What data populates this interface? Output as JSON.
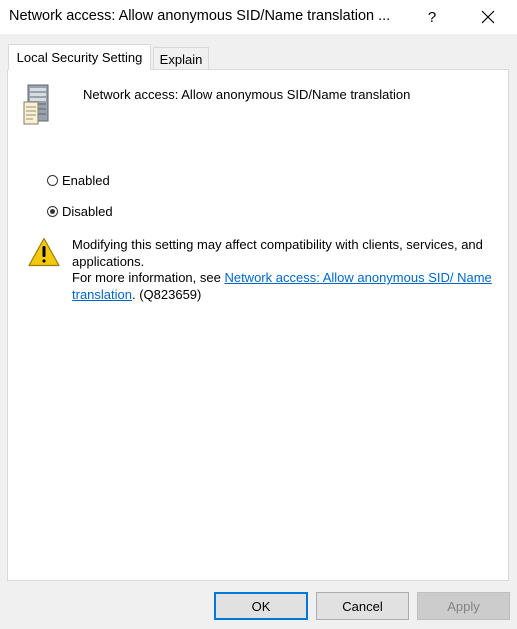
{
  "window": {
    "title": "Network access: Allow anonymous SID/Name translation ...",
    "help_label": "?",
    "close_icon": "close-icon"
  },
  "tabs": [
    {
      "label": "Local Security Setting",
      "active": true
    },
    {
      "label": "Explain",
      "active": false
    }
  ],
  "policy": {
    "icon": "server-policy-icon",
    "name": "Network access: Allow anonymous SID/Name translation"
  },
  "options": {
    "enabled_label": "Enabled",
    "disabled_label": "Disabled",
    "selected": "Disabled"
  },
  "warning": {
    "icon": "warning-icon",
    "line1": "Modifying this setting may affect compatibility with clients, services, and applications.",
    "line2_prefix": "For more information, see ",
    "link_text": "Network access: Allow anonymous SID/ Name translation",
    "line2_suffix": ". (Q823659)"
  },
  "buttons": {
    "ok": "OK",
    "cancel": "Cancel",
    "apply": "Apply"
  },
  "colors": {
    "link": "#0066cc",
    "ok_border": "#0078d7",
    "warning_yellow": "#f2c811"
  }
}
